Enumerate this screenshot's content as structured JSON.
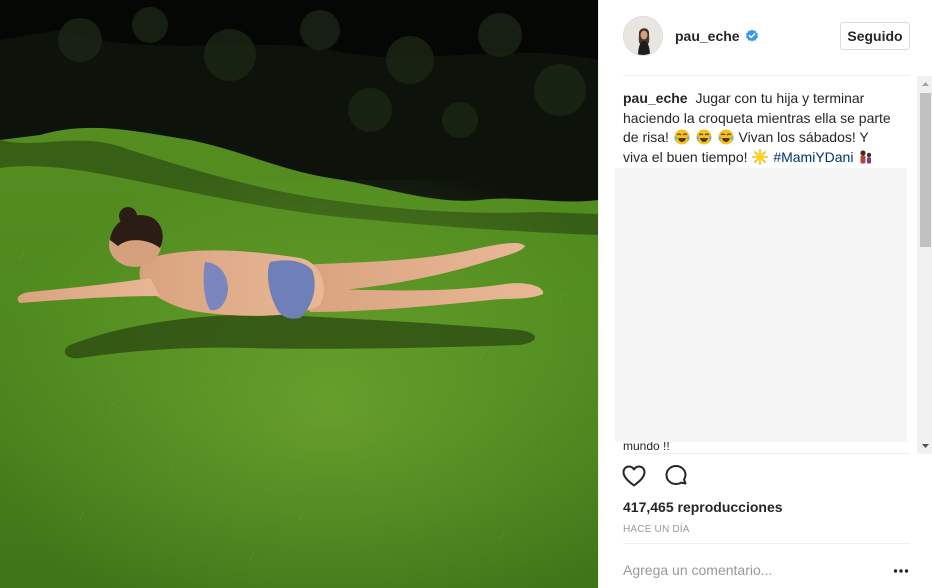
{
  "post": {
    "username": "pau_eche",
    "follow_label": "Seguido",
    "caption_user": "pau_eche",
    "caption_text_1": "Jugar con tu hija y terminar haciendo la croqueta mientras ella se parte de risa!",
    "caption_text_2": "Vivan los sábados! Y viva el buen tiempo!",
    "hashtag": "#MamiYDani",
    "cut_comment": "mundo !!",
    "views": "417,465 reproducciones",
    "timestamp": "HACE UN DÍA",
    "comment_placeholder": "Agrega un comentario..."
  },
  "icons": {
    "verified": "verified-badge-icon",
    "like": "heart-icon",
    "comment": "comment-bubble-icon",
    "more": "more-options-icon",
    "emoji_laugh": "tears-of-joy-emoji",
    "emoji_sun": "sun-emoji",
    "emoji_family": "mother-daughter-emoji",
    "emoji_heart": "heart-emoji"
  },
  "colors": {
    "verified_blue": "#3897f0",
    "hashtag": "#003569",
    "muted_text": "#999999",
    "border": "#dbdbdb"
  }
}
